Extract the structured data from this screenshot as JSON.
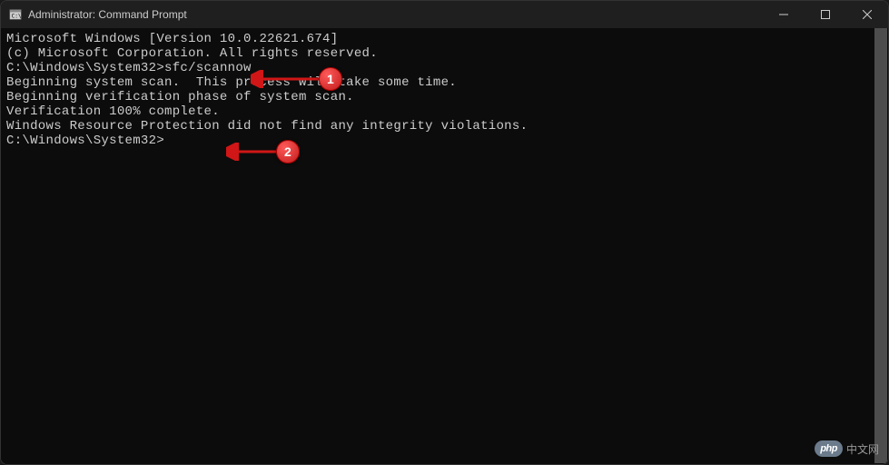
{
  "titlebar": {
    "title": "Administrator: Command Prompt"
  },
  "terminal": {
    "line1": "Microsoft Windows [Version 10.0.22621.674]",
    "line2": "(c) Microsoft Corporation. All rights reserved.",
    "blank1": "",
    "prompt1_path": "C:\\Windows\\System32>",
    "prompt1_cmd": "sfc/scannow",
    "blank2": "",
    "line3": "Beginning system scan.  This process will take some time.",
    "blank3": "",
    "line4": "Beginning verification phase of system scan.",
    "line5": "Verification 100% complete.",
    "blank4": "",
    "line6": "Windows Resource Protection did not find any integrity violations.",
    "blank5": "",
    "prompt2_path": "C:\\Windows\\System32>"
  },
  "annotations": {
    "badge1": "1",
    "badge2": "2"
  },
  "watermark": {
    "logo": "php",
    "text": "中文网"
  }
}
